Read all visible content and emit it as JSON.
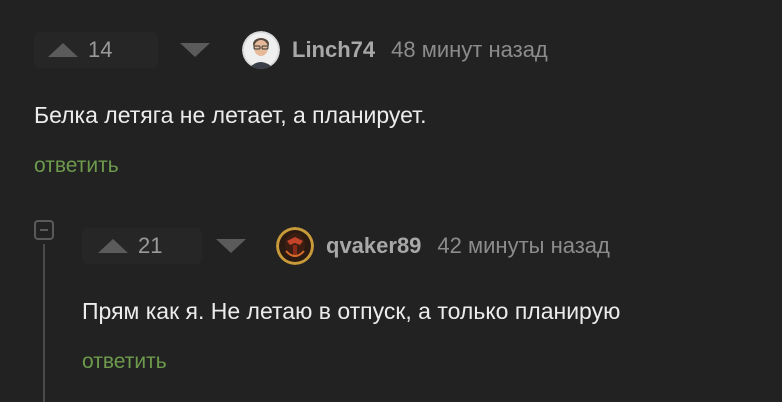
{
  "comments": [
    {
      "rating": "14",
      "username": "Linch74",
      "time": "48 минут назад",
      "text": "Белка летяга не летает, а планирует.",
      "reply_label": "ответить",
      "avatar_icon": "user-avatar-photo"
    },
    {
      "rating": "21",
      "username": "qvaker89",
      "time": "42 минуты назад",
      "text": "Прям как я. Не летаю в отпуск, а только планирую",
      "reply_label": "ответить",
      "avatar_icon": "user-avatar-helmet"
    }
  ],
  "colors": {
    "background": "#222222",
    "reply_link": "#6d9a4c",
    "text": "#ececec",
    "muted": "#8c8c8c"
  },
  "icons": {
    "upvote": "triangle-up-icon",
    "downvote": "triangle-down-icon",
    "collapse": "minus-square-icon"
  }
}
